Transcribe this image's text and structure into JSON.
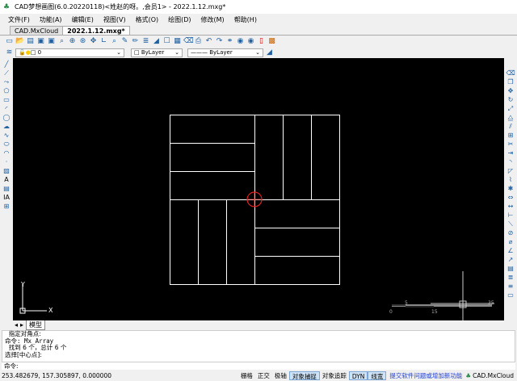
{
  "window": {
    "title": "CAD梦想画图(6.0.20220118)<姓赵的呀。,会员1> - 2022.1.12.mxg*"
  },
  "menu": [
    "文件(F)",
    "功能(A)",
    "编辑(E)",
    "视图(V)",
    "格式(O)",
    "绘图(D)",
    "修改(M)",
    "帮助(H)"
  ],
  "tabs": [
    "CAD.MxCloud",
    "2022.1.12.mxg*"
  ],
  "layer": {
    "value": "0",
    "color": "ByLayer",
    "linetype": "ByLayer"
  },
  "model_tab": "模型",
  "scale_bar": {
    "labels": [
      "5",
      "0",
      "15",
      "35"
    ]
  },
  "ucs": {
    "x": "X",
    "y": "Y"
  },
  "command_history": [
    "  指定对角点:",
    "命令: Mx_Array",
    "  找到 6 个，总计 6 个",
    "选择[中心点]:"
  ],
  "command_prompt": "命令:",
  "status": {
    "coords": "253.482679, 157.305897, 0.000000",
    "buttons": [
      {
        "label": "栅格",
        "on": false
      },
      {
        "label": "正交",
        "on": false
      },
      {
        "label": "极轴",
        "on": false
      },
      {
        "label": "对象捕捉",
        "on": true
      },
      {
        "label": "对象追踪",
        "on": false
      },
      {
        "label": "DYN",
        "on": true
      },
      {
        "label": "线宽",
        "on": true
      }
    ],
    "feedback_link": "提交软件问题或增加新功能",
    "brand": "CAD.MxCloud"
  },
  "colors": {
    "canvas": "#000000",
    "cursor": "#e02020",
    "accent": "#2060a0"
  }
}
